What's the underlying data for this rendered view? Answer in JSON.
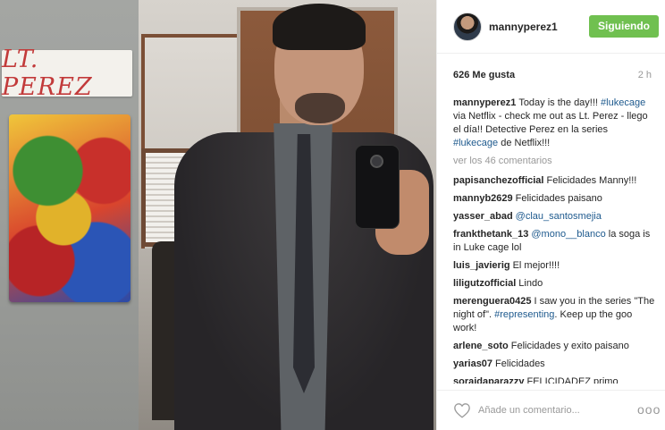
{
  "photo": {
    "sign_text": "LT. PEREZ",
    "alt_icons": [
      "marvel-poster",
      "selfie-phone"
    ]
  },
  "header": {
    "username": "mannyperez1",
    "follow_label": "Siguiendo",
    "follow_color": "#70c050"
  },
  "stats": {
    "likes": "626 Me gusta",
    "time": "2 h"
  },
  "caption": {
    "user": "mannyperez1",
    "parts": [
      {
        "text": "Today is the day!!! ",
        "link": false
      },
      {
        "text": "#lukecage",
        "link": true
      },
      {
        "text": " via Netflix - check me out as Lt. Perez - llego el día!! Detective Perez en la series ",
        "link": false
      },
      {
        "text": "#lukecage",
        "link": true
      },
      {
        "text": " de Netflix!!!",
        "link": false
      }
    ]
  },
  "view_all": "ver los 46 comentarios",
  "comments": [
    {
      "user": "papisanchezofficial",
      "parts": [
        {
          "text": "Felicidades Manny!!!",
          "link": false
        }
      ]
    },
    {
      "user": "mannyb2629",
      "parts": [
        {
          "text": "Felicidades paisano",
          "link": false
        }
      ]
    },
    {
      "user": "yasser_abad",
      "parts": [
        {
          "text": "@clau_santosmejia",
          "link": true
        }
      ]
    },
    {
      "user": "frankthetank_13",
      "parts": [
        {
          "text": "@mono__blanco",
          "link": true
        },
        {
          "text": " la soga is in Luke cage lol",
          "link": false
        }
      ]
    },
    {
      "user": "luis_javierig",
      "parts": [
        {
          "text": "El mejor!!!!",
          "link": false
        }
      ]
    },
    {
      "user": "liligutzofficial",
      "parts": [
        {
          "text": "Lindo",
          "link": false
        }
      ]
    },
    {
      "user": "merenguera0425",
      "parts": [
        {
          "text": "I saw you in the series \"The night of\". ",
          "link": false
        },
        {
          "text": "#representing",
          "link": true
        },
        {
          "text": ". Keep up the goo work!",
          "link": false
        }
      ]
    },
    {
      "user": "arlene_soto",
      "parts": [
        {
          "text": "Felicidades y exito paisano",
          "link": false
        }
      ]
    },
    {
      "user": "yarias07",
      "parts": [
        {
          "text": "Felicidades",
          "link": false
        }
      ]
    },
    {
      "user": "soraidaparazzy",
      "parts": [
        {
          "text": "FELICIDADEZ primo",
          "link": false
        }
      ]
    }
  ],
  "footer": {
    "heart_icon": "heart-outline-icon",
    "comment_placeholder": "Añade un comentario...",
    "more_label": "ooo"
  }
}
